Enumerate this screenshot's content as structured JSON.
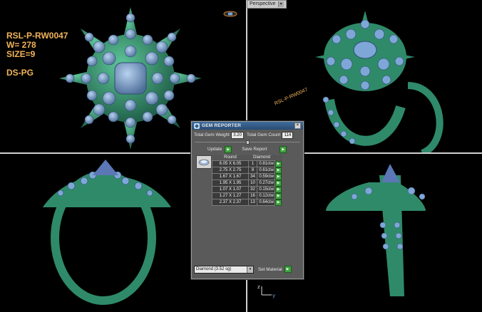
{
  "ring_info": {
    "model": "RSL-P-RW0047",
    "weight": "W= 278",
    "size": "SIZE=9",
    "designer": "DS-PG"
  },
  "viewport_label": "Perspective",
  "view_tag": "RSL-P-RW0047",
  "axis": {
    "y": "y",
    "z": "z"
  },
  "dialog": {
    "title": "GEM REPORTER",
    "total_weight_label": "Total Gem Weight",
    "total_weight_value": "3.20",
    "total_count_label": "Total Gem Count",
    "total_count_value": "114",
    "update_label": "Update",
    "save_report_label": "Save Report",
    "col_round": "Round",
    "col_diamond": "Diamond",
    "rows": [
      {
        "size": "6.05 X 6.05",
        "count": "1",
        "weight": "0.81ctw"
      },
      {
        "size": "2.75 X 2.75",
        "count": "8",
        "weight": "0.61ctw"
      },
      {
        "size": "1.67 X 1.67",
        "count": "34",
        "weight": "0.59ctw"
      },
      {
        "size": "1.95 X 1.95",
        "count": "10",
        "weight": "0.27ctw"
      },
      {
        "size": "1.07 X 1.07",
        "count": "32",
        "weight": "0.15ctw"
      },
      {
        "size": "1.27 X 1.27",
        "count": "16",
        "weight": "0.12ctw"
      },
      {
        "size": "2.37 X 2.37",
        "count": "13",
        "weight": "0.64ctw"
      }
    ],
    "material_select": "Diamond    (3.52 sg)",
    "set_material_label": "Set Material"
  },
  "colors": {
    "metal": "#2f8a6a",
    "gem": "#7ea6d6",
    "text_orange": "#f2b45a",
    "dialog_bg": "#5a5a5a",
    "button_green": "#3fa33f"
  }
}
